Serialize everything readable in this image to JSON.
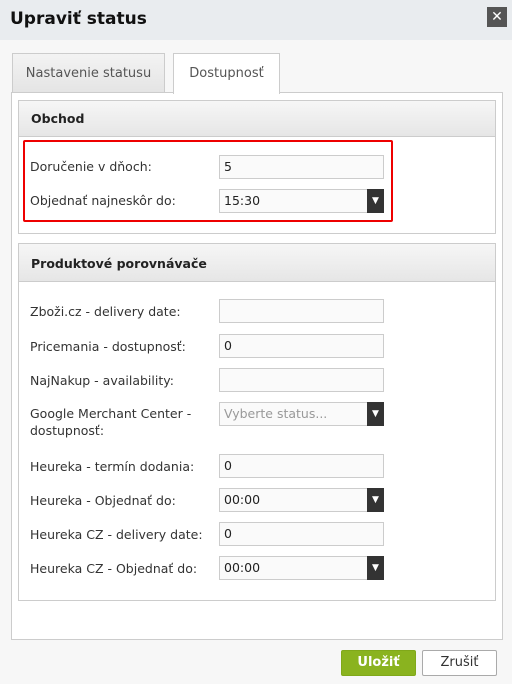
{
  "dialog": {
    "title": "Upraviť status",
    "close_icon": "close-icon"
  },
  "tabs": [
    {
      "label": "Nastavenie statusu",
      "active": false
    },
    {
      "label": "Dostupnosť",
      "active": true
    }
  ],
  "shop": {
    "title": "Obchod",
    "delivery_days": {
      "label": "Doručenie v dňoch:",
      "value": "5"
    },
    "order_by": {
      "label": "Objednať najneskôr do:",
      "value": "15:30"
    },
    "highlight_color": "#e00000"
  },
  "comparators": {
    "title": "Produktové porovnávače",
    "fields": [
      {
        "label": "Zboži.cz - delivery date:",
        "value": ""
      },
      {
        "label": "Pricemania - dostupnosť:",
        "value": "0"
      },
      {
        "label": "NajNakup - availability:",
        "value": ""
      },
      {
        "label": "Google Merchant Center - dostupnosť:",
        "placeholder": "Vyberte status..."
      },
      {
        "label": "Heureka - termín dodania:",
        "value": "0"
      },
      {
        "label": "Heureka - Objednať do:",
        "value": "00:00"
      },
      {
        "label": "Heureka CZ - delivery date:",
        "value": "0"
      },
      {
        "label": "Heureka CZ - Objednať do:",
        "value": "00:00"
      }
    ]
  },
  "footer": {
    "save_label": "Uložiť",
    "cancel_label": "Zrušiť",
    "save_color": "#8ab31f"
  }
}
